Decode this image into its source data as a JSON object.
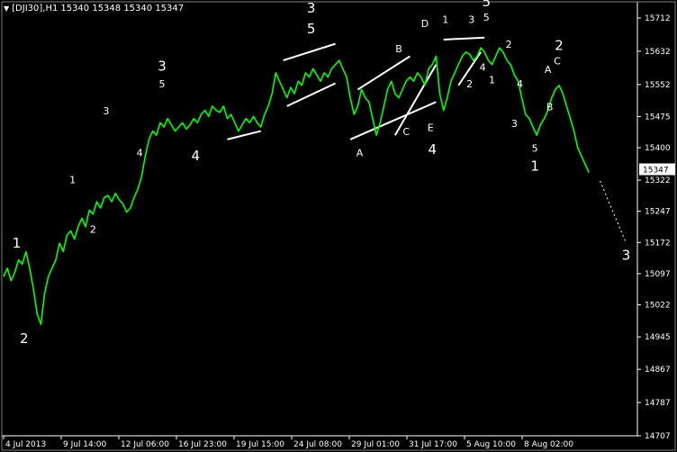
{
  "header": {
    "menu_icon": "triangle-down-icon",
    "symbol": "[DJI30],H1",
    "ohlc": "15340 15348 15340 15347"
  },
  "colors": {
    "background": "#000000",
    "price_line": "#00ff00",
    "axis": "#ffffff",
    "trend_lines": "#ffffff",
    "annotations": "#ffffff"
  },
  "chart_data": {
    "type": "line",
    "title": "[DJI30],H1",
    "ylim": [
      14707,
      15712
    ],
    "y_ticks": [
      15712,
      15632,
      15552,
      15475,
      15400,
      15322,
      15247,
      15172,
      15097,
      15022,
      14945,
      14867,
      14787,
      14707
    ],
    "x_tick_labels": [
      "4 Jul 2013",
      "9 Jul 14:00",
      "12 Jul 06:00",
      "16 Jul 23:00",
      "19 Jul 15:00",
      "24 Jul 08:00",
      "29 Jul 01:00",
      "31 Jul 17:00",
      "5 Aug 10:00",
      "8 Aug 02:00"
    ],
    "last_price": "15347",
    "grid": false,
    "series": [
      {
        "color": "#00ff00",
        "points": [
          [
            0,
            15090
          ],
          [
            2,
            15110
          ],
          [
            4,
            15080
          ],
          [
            6,
            15100
          ],
          [
            8,
            15130
          ],
          [
            10,
            15120
          ],
          [
            12,
            15150
          ],
          [
            14,
            15110
          ],
          [
            16,
            15060
          ],
          [
            18,
            15000
          ],
          [
            20,
            14975
          ],
          [
            22,
            15050
          ],
          [
            24,
            15090
          ],
          [
            26,
            15110
          ],
          [
            28,
            15130
          ],
          [
            30,
            15170
          ],
          [
            32,
            15150
          ],
          [
            34,
            15190
          ],
          [
            36,
            15200
          ],
          [
            38,
            15180
          ],
          [
            40,
            15210
          ],
          [
            42,
            15230
          ],
          [
            44,
            15210
          ],
          [
            46,
            15250
          ],
          [
            48,
            15240
          ],
          [
            50,
            15270
          ],
          [
            52,
            15255
          ],
          [
            54,
            15280
          ],
          [
            56,
            15285
          ],
          [
            58,
            15270
          ],
          [
            60,
            15290
          ],
          [
            62,
            15275
          ],
          [
            64,
            15265
          ],
          [
            66,
            15245
          ],
          [
            68,
            15255
          ],
          [
            70,
            15280
          ],
          [
            72,
            15300
          ],
          [
            74,
            15330
          ],
          [
            76,
            15380
          ],
          [
            78,
            15420
          ],
          [
            80,
            15440
          ],
          [
            82,
            15430
          ],
          [
            84,
            15460
          ],
          [
            86,
            15450
          ],
          [
            88,
            15470
          ],
          [
            90,
            15455
          ],
          [
            92,
            15440
          ],
          [
            94,
            15450
          ],
          [
            96,
            15460
          ],
          [
            98,
            15445
          ],
          [
            100,
            15455
          ],
          [
            102,
            15470
          ],
          [
            104,
            15460
          ],
          [
            106,
            15480
          ],
          [
            108,
            15490
          ],
          [
            110,
            15475
          ],
          [
            112,
            15500
          ],
          [
            114,
            15490
          ],
          [
            116,
            15485
          ],
          [
            118,
            15500
          ],
          [
            120,
            15470
          ],
          [
            122,
            15480
          ],
          [
            124,
            15460
          ],
          [
            126,
            15440
          ],
          [
            128,
            15455
          ],
          [
            130,
            15470
          ],
          [
            132,
            15460
          ],
          [
            134,
            15475
          ],
          [
            136,
            15460
          ],
          [
            138,
            15450
          ],
          [
            140,
            15480
          ],
          [
            142,
            15500
          ],
          [
            144,
            15530
          ],
          [
            146,
            15580
          ],
          [
            148,
            15560
          ],
          [
            150,
            15540
          ],
          [
            152,
            15520
          ],
          [
            154,
            15545
          ],
          [
            156,
            15530
          ],
          [
            158,
            15560
          ],
          [
            160,
            15550
          ],
          [
            162,
            15580
          ],
          [
            164,
            15570
          ],
          [
            166,
            15590
          ],
          [
            168,
            15575
          ],
          [
            170,
            15560
          ],
          [
            172,
            15580
          ],
          [
            174,
            15570
          ],
          [
            176,
            15590
          ],
          [
            178,
            15600
          ],
          [
            180,
            15610
          ],
          [
            182,
            15590
          ],
          [
            184,
            15570
          ],
          [
            186,
            15520
          ],
          [
            188,
            15480
          ],
          [
            190,
            15500
          ],
          [
            192,
            15540
          ],
          [
            194,
            15520
          ],
          [
            196,
            15510
          ],
          [
            198,
            15470
          ],
          [
            200,
            15430
          ],
          [
            202,
            15460
          ],
          [
            204,
            15500
          ],
          [
            206,
            15540
          ],
          [
            208,
            15560
          ],
          [
            210,
            15530
          ],
          [
            212,
            15520
          ],
          [
            214,
            15540
          ],
          [
            216,
            15560
          ],
          [
            218,
            15570
          ],
          [
            220,
            15560
          ],
          [
            222,
            15580
          ],
          [
            224,
            15570
          ],
          [
            226,
            15550
          ],
          [
            228,
            15590
          ],
          [
            230,
            15600
          ],
          [
            232,
            15620
          ],
          [
            234,
            15530
          ],
          [
            236,
            15490
          ],
          [
            238,
            15520
          ],
          [
            240,
            15560
          ],
          [
            242,
            15580
          ],
          [
            244,
            15600
          ],
          [
            246,
            15620
          ],
          [
            248,
            15630
          ],
          [
            250,
            15625
          ],
          [
            252,
            15610
          ],
          [
            254,
            15620
          ],
          [
            256,
            15640
          ],
          [
            258,
            15630
          ],
          [
            260,
            15610
          ],
          [
            262,
            15600
          ],
          [
            264,
            15620
          ],
          [
            266,
            15640
          ],
          [
            268,
            15630
          ],
          [
            270,
            15610
          ],
          [
            272,
            15600
          ],
          [
            274,
            15575
          ],
          [
            276,
            15560
          ],
          [
            278,
            15520
          ],
          [
            280,
            15480
          ],
          [
            282,
            15470
          ],
          [
            284,
            15450
          ],
          [
            286,
            15430
          ],
          [
            288,
            15455
          ],
          [
            290,
            15470
          ],
          [
            292,
            15490
          ],
          [
            294,
            15520
          ],
          [
            296,
            15540
          ],
          [
            298,
            15550
          ],
          [
            300,
            15530
          ],
          [
            302,
            15500
          ],
          [
            304,
            15470
          ],
          [
            306,
            15440
          ],
          [
            308,
            15400
          ],
          [
            310,
            15380
          ],
          [
            312,
            15360
          ],
          [
            314,
            15340
          ]
        ]
      }
    ],
    "trend_lines": [
      [
        [
          210,
          15430
        ],
        [
          232,
          15600
        ]
      ],
      [
        [
          120,
          15420
        ],
        [
          138,
          15440
        ]
      ],
      [
        [
          150,
          15610
        ],
        [
          178,
          15650
        ]
      ],
      [
        [
          152,
          15500
        ],
        [
          178,
          15555
        ]
      ],
      [
        [
          186,
          15420
        ],
        [
          232,
          15510
        ]
      ],
      [
        [
          190,
          15540
        ],
        [
          218,
          15620
        ]
      ],
      [
        [
          236,
          15660
        ],
        [
          258,
          15665
        ]
      ],
      [
        [
          244,
          15550
        ],
        [
          256,
          15630
        ]
      ]
    ],
    "projection": [
      [
        320,
        15320
      ],
      [
        334,
        15170
      ]
    ],
    "wave_labels": [
      {
        "text": "1",
        "x": 7,
        "y": 15160,
        "size": "large"
      },
      {
        "text": "2",
        "x": 11,
        "y": 14930,
        "size": "large"
      },
      {
        "text": "1",
        "x": 37,
        "y": 15315,
        "size": "small"
      },
      {
        "text": "2",
        "x": 48,
        "y": 15195,
        "size": "small"
      },
      {
        "text": "3",
        "x": 55,
        "y": 15480,
        "size": "small"
      },
      {
        "text": "4",
        "x": 73,
        "y": 15380,
        "size": "small"
      },
      {
        "text": "3",
        "x": 85,
        "y": 15585,
        "size": "large"
      },
      {
        "text": "5",
        "x": 85,
        "y": 15545,
        "size": "small"
      },
      {
        "text": "4",
        "x": 103,
        "y": 15370,
        "size": "large"
      },
      {
        "text": "3",
        "x": 165,
        "y": 15725,
        "size": "large"
      },
      {
        "text": "5",
        "x": 165,
        "y": 15675,
        "size": "large"
      },
      {
        "text": "A",
        "x": 191,
        "y": 15380,
        "size": "small"
      },
      {
        "text": "B",
        "x": 212,
        "y": 15630,
        "size": "small"
      },
      {
        "text": "C",
        "x": 216,
        "y": 15430,
        "size": "small"
      },
      {
        "text": "D",
        "x": 226,
        "y": 15690,
        "size": "small"
      },
      {
        "text": "E",
        "x": 229,
        "y": 15440,
        "size": "small"
      },
      {
        "text": "4",
        "x": 230,
        "y": 15385,
        "size": "large"
      },
      {
        "text": "1",
        "x": 237,
        "y": 15700,
        "size": "small"
      },
      {
        "text": "3",
        "x": 251,
        "y": 15700,
        "size": "small"
      },
      {
        "text": "5",
        "x": 259,
        "y": 15740,
        "size": "large"
      },
      {
        "text": "5",
        "x": 259,
        "y": 15705,
        "size": "small"
      },
      {
        "text": "2",
        "x": 250,
        "y": 15545,
        "size": "small"
      },
      {
        "text": "4",
        "x": 257,
        "y": 15585,
        "size": "small"
      },
      {
        "text": "1",
        "x": 262,
        "y": 15555,
        "size": "small"
      },
      {
        "text": "2",
        "x": 271,
        "y": 15640,
        "size": "small"
      },
      {
        "text": "4",
        "x": 277,
        "y": 15545,
        "size": "small"
      },
      {
        "text": "3",
        "x": 274,
        "y": 15450,
        "size": "small"
      },
      {
        "text": "5",
        "x": 285,
        "y": 15390,
        "size": "small"
      },
      {
        "text": "1",
        "x": 285,
        "y": 15345,
        "size": "large"
      },
      {
        "text": "A",
        "x": 292,
        "y": 15580,
        "size": "small"
      },
      {
        "text": "C",
        "x": 297,
        "y": 15600,
        "size": "small"
      },
      {
        "text": "2",
        "x": 298,
        "y": 15635,
        "size": "large"
      },
      {
        "text": "B",
        "x": 293,
        "y": 15490,
        "size": "small"
      },
      {
        "text": "3",
        "x": 334,
        "y": 15130,
        "size": "large"
      }
    ]
  }
}
